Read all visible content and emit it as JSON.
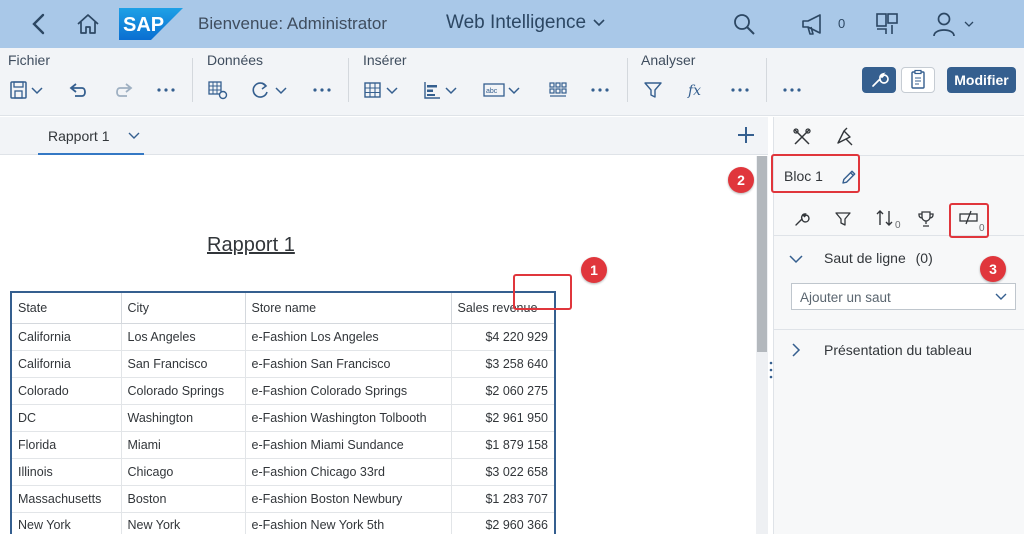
{
  "shell": {
    "welcome": "Bienvenue: Administrator",
    "app_title": "Web Intelligence",
    "notifications_count": "0",
    "logo_text": "SAP"
  },
  "toolbar": {
    "groups": {
      "file": "Fichier",
      "data": "Données",
      "insert": "Insérer",
      "analyze": "Analyser"
    },
    "modify_label": "Modifier"
  },
  "report": {
    "tab_label": "Rapport 1",
    "title": "Rapport 1",
    "table": {
      "headers": [
        "State",
        "City",
        "Store name",
        "Sales revenue"
      ],
      "rows": [
        [
          "California",
          "Los Angeles",
          "e-Fashion Los Angeles",
          "$4 220 929"
        ],
        [
          "California",
          "San Francisco",
          "e-Fashion San Francisco",
          "$3 258 640"
        ],
        [
          "Colorado",
          "Colorado Springs",
          "e-Fashion Colorado Springs",
          "$2 060 275"
        ],
        [
          "DC",
          "Washington",
          "e-Fashion Washington Tolbooth",
          "$2 961 950"
        ],
        [
          "Florida",
          "Miami",
          "e-Fashion Miami Sundance",
          "$1 879 158"
        ],
        [
          "Illinois",
          "Chicago",
          "e-Fashion Chicago 33rd",
          "$3 022 658"
        ],
        [
          "Massachusetts",
          "Boston",
          "e-Fashion Boston Newbury",
          "$1 283 707"
        ],
        [
          "New York",
          "New York",
          "e-Fashion New York 5th",
          "$2 960 366"
        ]
      ]
    }
  },
  "panel": {
    "block_name": "Bloc 1",
    "sort_count": "0",
    "breaks_count": "0",
    "line_break_title": "Saut de ligne",
    "line_break_count": "(0)",
    "add_break_placeholder": "Ajouter un saut",
    "table_presentation_title": "Présentation du tableau"
  },
  "callouts": [
    "1",
    "2",
    "3"
  ],
  "colors": {
    "shell_bg": "#a9c8e8",
    "accent": "#355f8f",
    "callout_red": "#e0363c",
    "tab_indicator": "#3478c4"
  }
}
